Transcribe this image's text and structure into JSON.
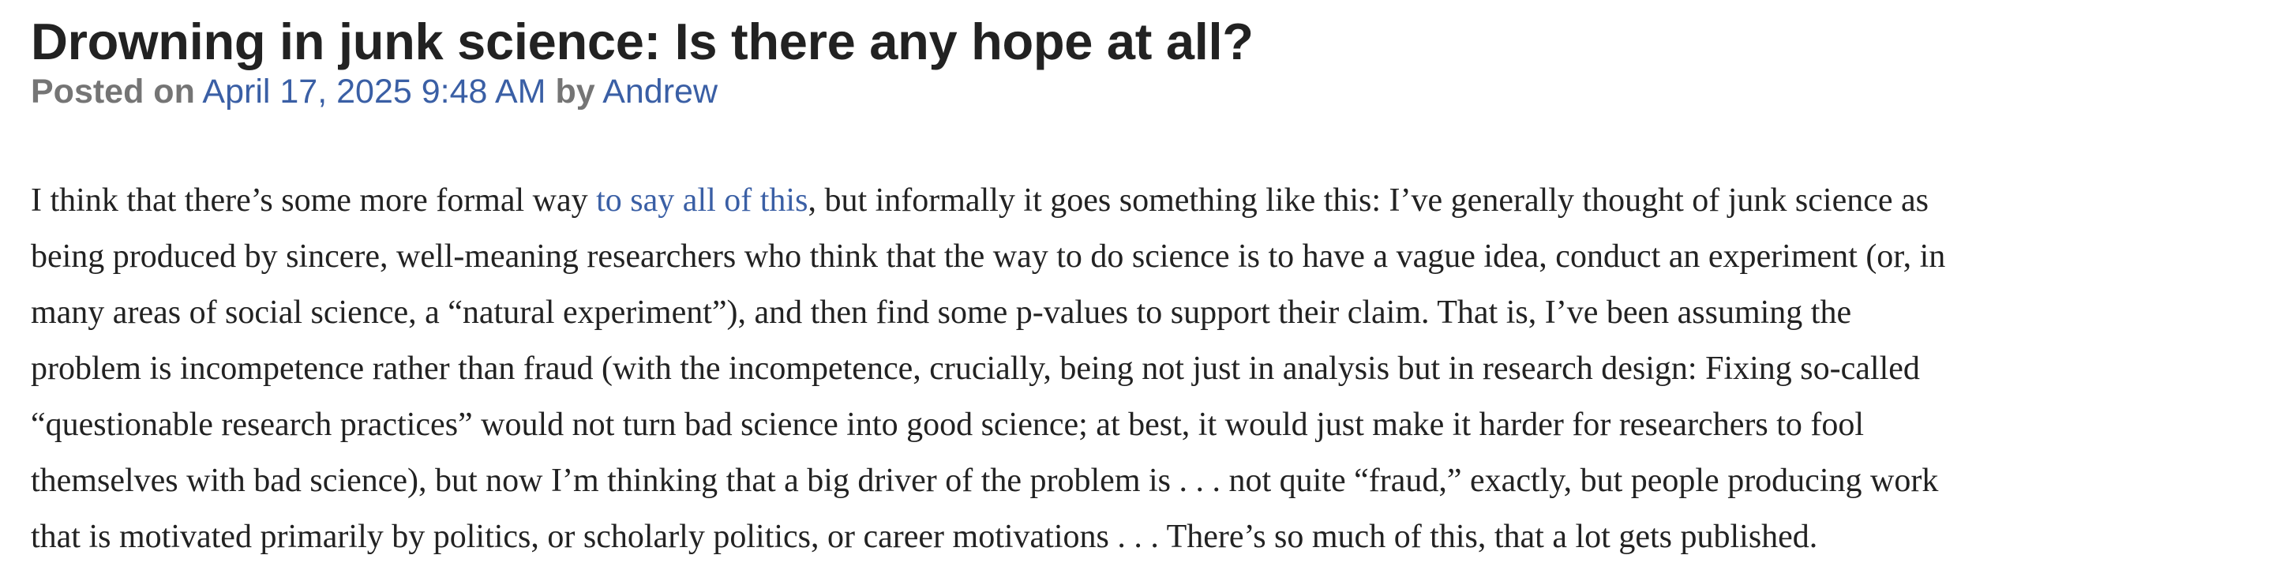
{
  "post": {
    "title": "Drowning in junk science: Is there any hope at all?",
    "meta": {
      "posted_on_label": "Posted on",
      "date": "April 17, 2025 9:48 AM",
      "by_label": "by",
      "author": "Andrew"
    },
    "body": {
      "line1_before_link": "I think that there’s some more formal way ",
      "link_text": "to say all of this",
      "line1_after_link": ", but informally it goes something like this: I’ve generally thought of junk science as",
      "line2": "being produced by sincere, well-meaning researchers who think that the way to do science is to have a vague idea, conduct an experiment (or, in",
      "line3": "many areas of social science, a “natural experiment”), and then find some p-values to support their claim. That is, I’ve been assuming the",
      "line4": "problem is incompetence rather than fraud (with the incompetence, crucially, being not just in analysis but in research design: Fixing so-called",
      "line5": "“questionable research practices” would not turn bad science into good science; at best, it would just make it harder for researchers to fool",
      "line6": "themselves with bad science), but now I’m thinking that a big driver of the problem is . . . not quite “fraud,” exactly, but people producing work",
      "line7": "that is motivated primarily by politics, or scholarly politics, or career motivations . . . There’s so much of this, that a lot gets published."
    }
  },
  "colors": {
    "title": "#222222",
    "meta_text": "#757575",
    "link": "#3a5fa5",
    "body_text": "#222222",
    "background": "#ffffff"
  }
}
